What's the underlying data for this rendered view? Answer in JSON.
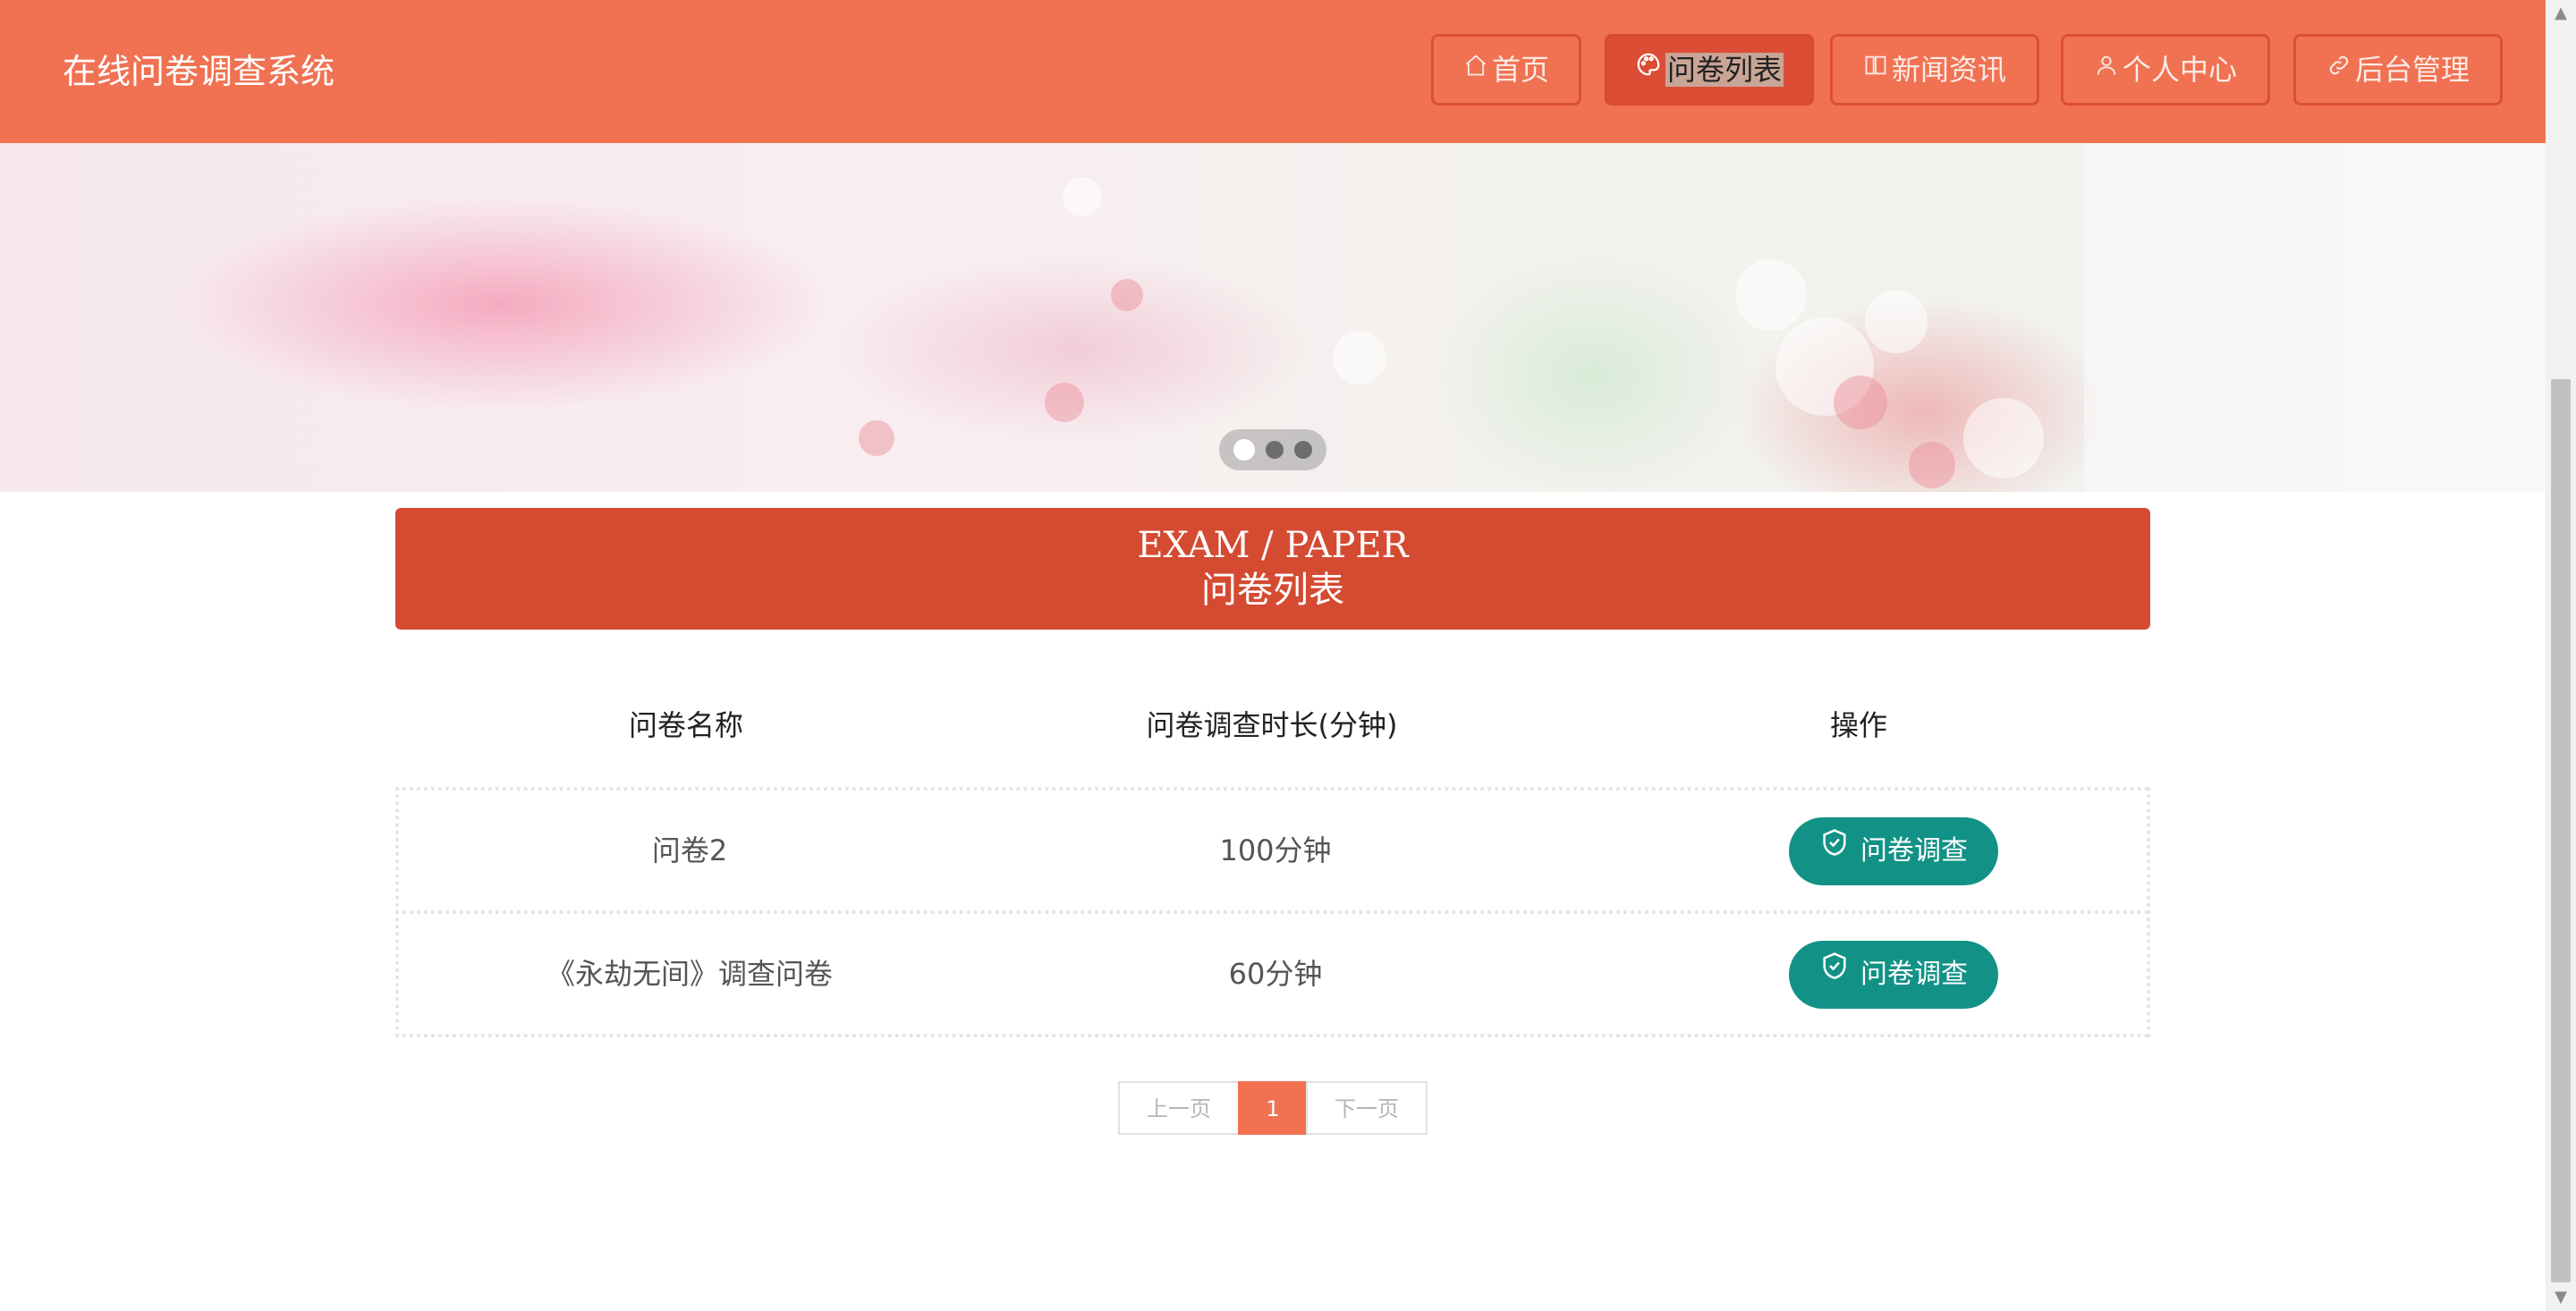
{
  "header": {
    "site_title": "在线问卷调查系统",
    "nav": [
      {
        "label": "首页",
        "icon": "home-icon",
        "active": false
      },
      {
        "label": "问卷列表",
        "icon": "palette-icon",
        "active": true
      },
      {
        "label": "新闻资讯",
        "icon": "news-icon",
        "active": false
      },
      {
        "label": "个人中心",
        "icon": "user-icon",
        "active": false
      },
      {
        "label": "后台管理",
        "icon": "link-icon",
        "active": false
      }
    ]
  },
  "banner": {
    "slide_count": 3,
    "active_slide": 1
  },
  "section": {
    "title_en": "EXAM / PAPER",
    "title_cn": "问卷列表"
  },
  "table": {
    "columns": [
      "问卷名称",
      "问卷调查时长(分钟)",
      "操作"
    ],
    "rows": [
      {
        "name": "问卷2",
        "duration": "100分钟",
        "action": "问卷调查"
      },
      {
        "name": "《永劫无间》调查问卷",
        "duration": "60分钟",
        "action": "问卷调查"
      }
    ]
  },
  "pagination": {
    "prev": "上一页",
    "current": "1",
    "next": "下一页"
  },
  "colors": {
    "header_bg": "#f07252",
    "section_title_bg": "#d44b32",
    "action_button_bg": "#129286",
    "pager_active": "#f07252"
  }
}
